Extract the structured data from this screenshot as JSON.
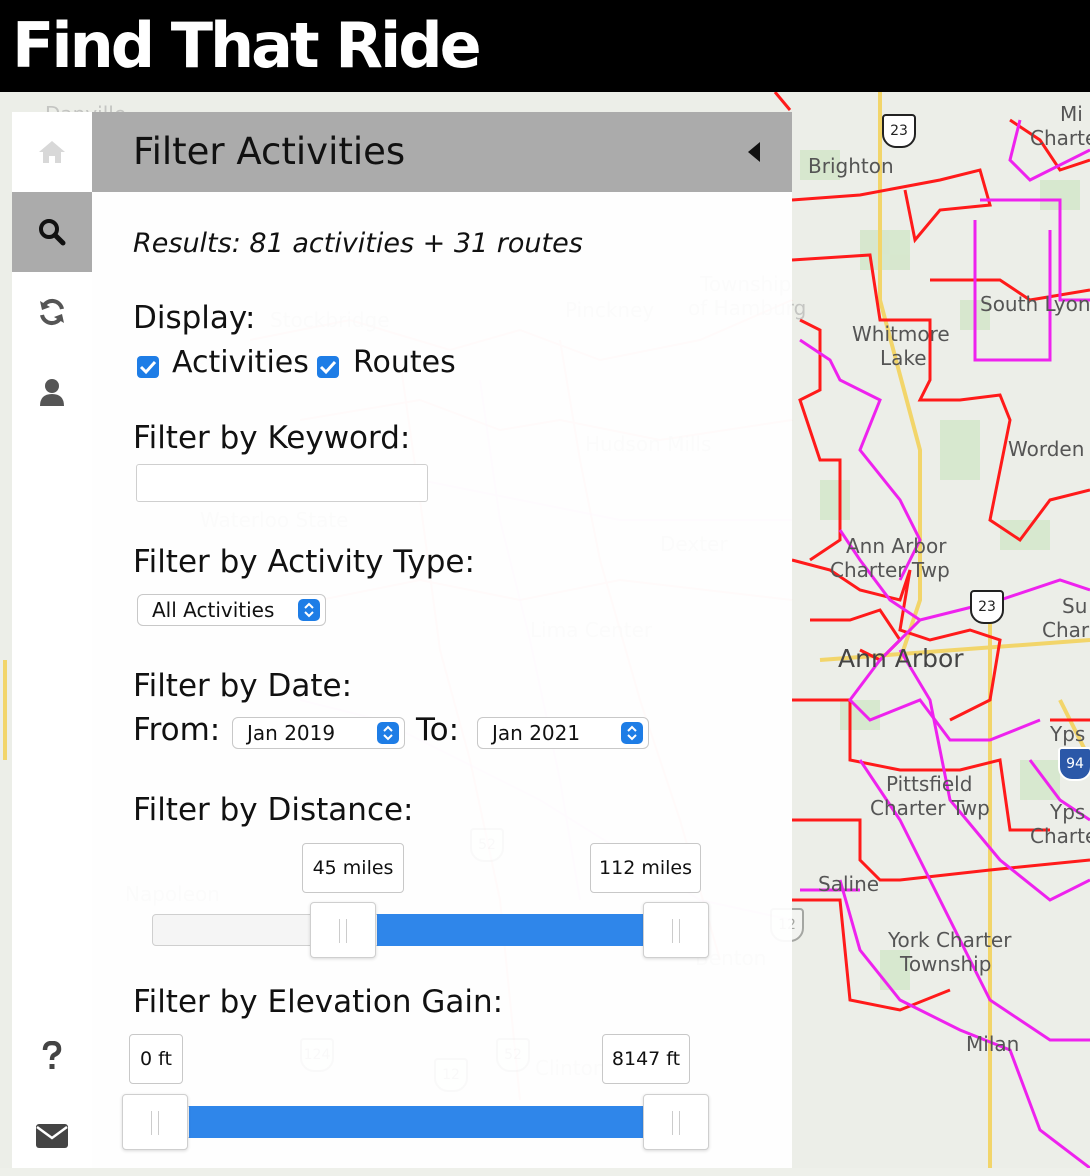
{
  "app": {
    "title": "Find That Ride"
  },
  "map": {
    "places": [
      {
        "name": "Brighton"
      },
      {
        "name": "Whitmore"
      },
      {
        "name": "Lake"
      },
      {
        "name": "South Lyon"
      },
      {
        "name": "Worden"
      },
      {
        "name": "Ann Arbor"
      },
      {
        "name": "Charter Twp"
      },
      {
        "name": "Ann Arbor"
      },
      {
        "name": "Pittsfield"
      },
      {
        "name": "Charter Twp"
      },
      {
        "name": "Saline"
      },
      {
        "name": "York Charter"
      },
      {
        "name": "Township"
      },
      {
        "name": "Milan"
      },
      {
        "name": "Yps"
      },
      {
        "name": "Yps"
      },
      {
        "name": "Charte"
      },
      {
        "name": "Su"
      },
      {
        "name": "Char"
      },
      {
        "name": "Mi"
      },
      {
        "name": "Charte"
      },
      {
        "name": "Pinckney"
      },
      {
        "name": "Township"
      },
      {
        "name": "of Hamburg"
      },
      {
        "name": "Waterloo State"
      },
      {
        "name": "Lima Center"
      },
      {
        "name": "Napoleon"
      },
      {
        "name": "Benton"
      },
      {
        "name": "Clinton"
      },
      {
        "name": "Dexter"
      },
      {
        "name": "Hudson Mills"
      },
      {
        "name": "Danville"
      },
      {
        "name": "Stockbridge"
      }
    ],
    "shields": [
      "23",
      "23",
      "94",
      "12",
      "124",
      "52",
      "12",
      "52"
    ]
  },
  "nav": {
    "items": [
      {
        "name": "home",
        "icon": "home-icon",
        "active": false
      },
      {
        "name": "search",
        "icon": "search-icon",
        "active": true
      },
      {
        "name": "refresh",
        "icon": "refresh-icon",
        "active": false
      },
      {
        "name": "account",
        "icon": "user-icon",
        "active": false
      }
    ],
    "bottom": [
      {
        "name": "help",
        "icon": "question-icon"
      },
      {
        "name": "contact",
        "icon": "envelope-icon"
      }
    ]
  },
  "panel": {
    "title": "Filter Activities",
    "results": "Results: 81 activities + 31 routes",
    "display": {
      "label": "Display:",
      "activities": {
        "label": "Activities",
        "checked": true
      },
      "routes": {
        "label": "Routes",
        "checked": true
      }
    },
    "keyword": {
      "label": "Filter by Keyword:",
      "value": "",
      "placeholder": ""
    },
    "activity_type": {
      "label": "Filter by Activity Type:",
      "selected": "All Activities"
    },
    "date": {
      "label": "Filter by Date:",
      "from_label": "From:",
      "from_value": "Jan 2019",
      "to_label": "To:",
      "to_value": "Jan 2021"
    },
    "distance": {
      "label": "Filter by Distance:",
      "min_label": "45 miles",
      "max_label": "112 miles",
      "min_fraction": 0.36,
      "max_fraction": 1.0
    },
    "elevation": {
      "label": "Filter by Elevation Gain:",
      "min_label": "0 ft",
      "max_label": "8147 ft",
      "min_fraction": 0.0,
      "max_fraction": 1.0
    }
  },
  "colors": {
    "header_bg": "#000000",
    "active_nav": "#ababab",
    "accent": "#2f86ea",
    "route_red": "#ff1a1a",
    "route_magenta": "#ee22ee"
  }
}
